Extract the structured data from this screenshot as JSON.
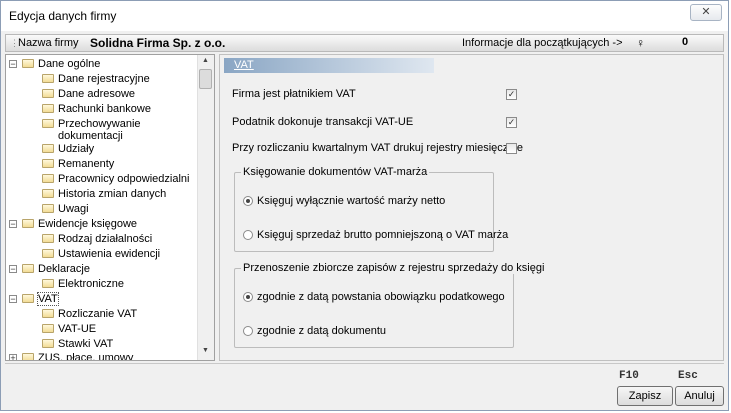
{
  "window": {
    "title": "Edycja danych firmy",
    "close_glyph": "✕"
  },
  "infobar": {
    "firm_label": "Nazwa firmy",
    "firm_name": "Solidna Firma Sp. z o.o.",
    "info_link": "Informacje dla początkujących ->",
    "info_icon": "person-help-icon",
    "info_number": "0"
  },
  "tree": {
    "items": [
      {
        "label": "Dane ogólne",
        "level": 0,
        "expanded": true
      },
      {
        "label": "Dane rejestracyjne",
        "level": 1
      },
      {
        "label": "Dane adresowe",
        "level": 1
      },
      {
        "label": "Rachunki bankowe",
        "level": 1
      },
      {
        "label": "Przechowywanie dokumentacji",
        "level": 1
      },
      {
        "label": "Udziały",
        "level": 1
      },
      {
        "label": "Remanenty",
        "level": 1
      },
      {
        "label": "Pracownicy odpowiedzialni",
        "level": 1
      },
      {
        "label": "Historia zmian danych",
        "level": 1
      },
      {
        "label": "Uwagi",
        "level": 1
      },
      {
        "label": "Ewidencje księgowe",
        "level": 0,
        "expanded": true
      },
      {
        "label": "Rodzaj działalności",
        "level": 1
      },
      {
        "label": "Ustawienia ewidencji",
        "level": 1
      },
      {
        "label": "Deklaracje",
        "level": 0,
        "expanded": true
      },
      {
        "label": "Elektroniczne",
        "level": 1
      },
      {
        "label": "VAT",
        "level": 0,
        "expanded": true,
        "selected": true
      },
      {
        "label": "Rozliczanie VAT",
        "level": 1
      },
      {
        "label": "VAT-UE",
        "level": 1
      },
      {
        "label": "Stawki VAT",
        "level": 1
      },
      {
        "label": "ZUS, płace, umowy",
        "level": 0
      }
    ]
  },
  "panel": {
    "header": "VAT",
    "checkboxes": [
      {
        "label": "Firma jest płatnikiem VAT",
        "checked": true
      },
      {
        "label": "Podatnik dokonuje transakcji VAT-UE",
        "checked": true
      },
      {
        "label": "Przy rozliczaniu kwartalnym VAT drukuj rejestry miesięcznie",
        "checked": false
      }
    ],
    "group1": {
      "title": "Księgowanie dokumentów VAT-marża",
      "options": [
        {
          "label": "Księguj wyłącznie wartość marży netto",
          "selected": true
        },
        {
          "label": "Księguj sprzedaż brutto pomniejszoną o VAT marża",
          "selected": false
        }
      ]
    },
    "group2": {
      "title": "Przenoszenie zbiorcze zapisów z rejestru sprzedaży do księgi",
      "options": [
        {
          "label": "zgodnie z datą powstania obowiązku podatkowego",
          "selected": true
        },
        {
          "label": "zgodnie z datą dokumentu",
          "selected": false
        }
      ]
    }
  },
  "footer": {
    "save_key": "F10",
    "save_label": "Zapisz",
    "cancel_key": "Esc",
    "cancel_label": "Anuluj"
  }
}
